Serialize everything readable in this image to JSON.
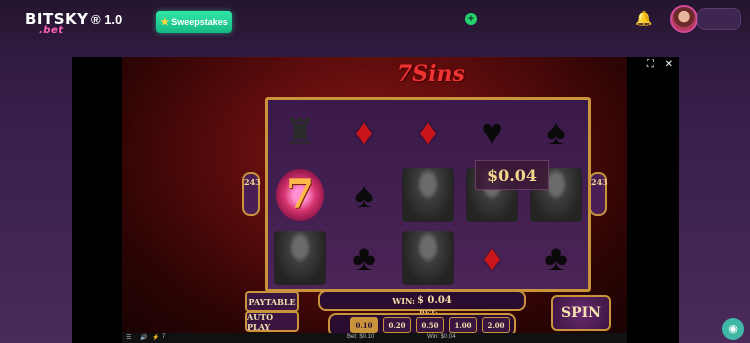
{
  "header": {
    "logo_text": "BITSKY",
    "logo_sub": ".bet",
    "version": "® 1.0",
    "sweepstakes_label": "Sweepstakes",
    "plus_label": "+"
  },
  "game": {
    "title": "7Sins",
    "ways": "243",
    "win_popup": "$0.04",
    "paytable_label": "PAYTABLE",
    "autoplay_label": "AUTO PLAY",
    "win_label": "WIN:",
    "win_value": "$ 0.04",
    "bet_label": "BET:",
    "bet_options": [
      "0.10",
      "0.20",
      "0.50",
      "1.00",
      "2.00"
    ],
    "bet_selected_index": 0,
    "spin_label": "SPIN",
    "status": {
      "bet": "Bet: $0.10",
      "win": "Win: $0.04",
      "count": "7"
    }
  },
  "reels": [
    [
      "bell-grey",
      "seven",
      "portrait"
    ],
    [
      "diamond-red",
      "spade",
      "club"
    ],
    [
      "blank",
      "portrait",
      "portrait"
    ],
    [
      "heart-grey",
      "portrait",
      "diamond-red"
    ],
    [
      "spade",
      "portrait",
      "club"
    ]
  ],
  "colors": {
    "accent_gold": "#c9943b",
    "sweep_green": "#1fc98f",
    "brand_pink": "#ff5fb5"
  }
}
